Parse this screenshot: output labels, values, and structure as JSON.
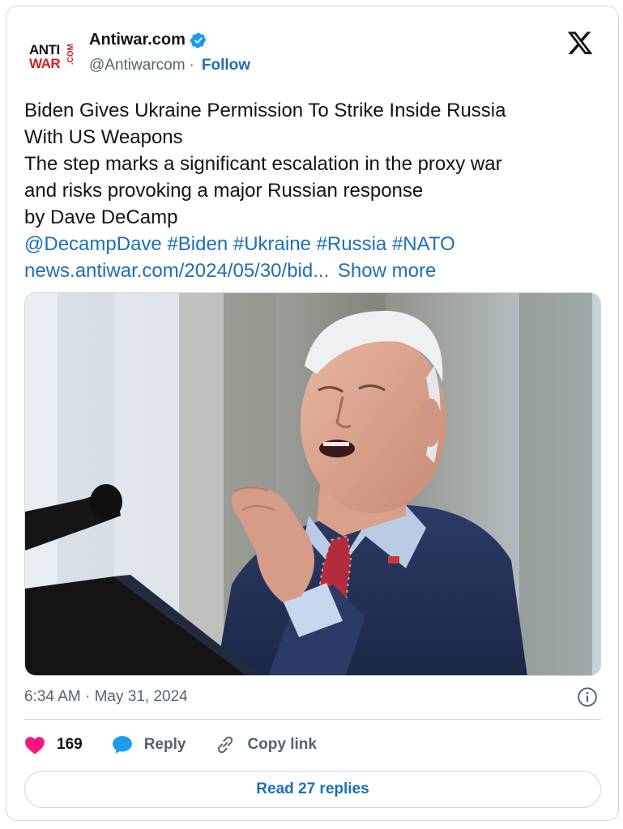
{
  "account": {
    "display_name": "Antiwar.com",
    "handle": "@Antiwarcom",
    "separator": "·",
    "follow_label": "Follow",
    "logo_line1": "ANTI",
    "logo_line2": "WAR",
    "logo_suffix": ".COM"
  },
  "tweet": {
    "lines": [
      "Biden Gives Ukraine Permission To Strike Inside Russia",
      "With US Weapons",
      "The step marks a significant escalation in the proxy war",
      "and risks provoking a major Russian response",
      "by Dave DeCamp"
    ],
    "mention": "@DecampDave",
    "hashtags": [
      "#Biden",
      "#Ukraine",
      "#Russia",
      "#NATO"
    ],
    "link_text": "news.antiwar.com/2024/05/30/bid...",
    "show_more_label": "Show more",
    "timestamp": "6:34 AM · May 31, 2024"
  },
  "actions": {
    "like_count": "169",
    "reply_label": "Reply",
    "copy_link_label": "Copy link",
    "read_replies_label": "Read 27 replies"
  },
  "icons": {
    "verified": "verified-badge-icon",
    "x_logo": "x-logo-icon",
    "info": "info-icon",
    "heart": "heart-icon",
    "reply": "speech-bubble-icon",
    "copy_link": "link-icon"
  },
  "colors": {
    "link_blue": "#1d6fb8",
    "heart_pink": "#f91880",
    "verified_blue": "#1d9bf0",
    "secondary_text": "#536471",
    "border": "#cfd9de"
  }
}
